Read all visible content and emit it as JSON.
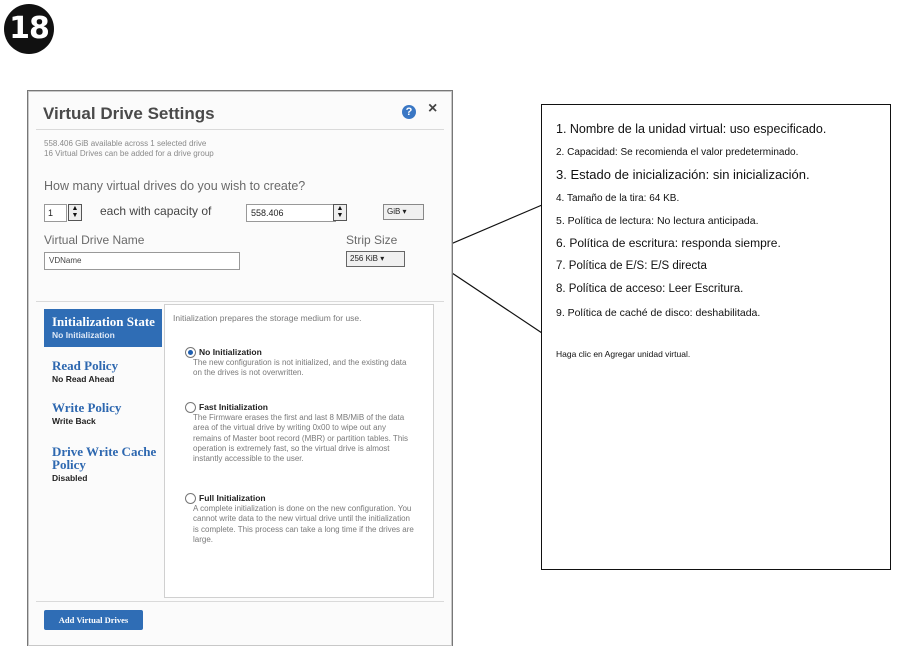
{
  "step": {
    "number": "18"
  },
  "dialog": {
    "title": "Virtual Drive Settings",
    "help_glyph": "?",
    "close_glyph": "×",
    "info_lines": [
      "558.406 GiB available across 1 selected drive",
      "16 Virtual Drives can be added for a drive group"
    ],
    "question": "How many virtual drives do you wish to create?",
    "count_value": "1",
    "capacity_label": "each with capacity of",
    "capacity_value": "558.406",
    "capacity_unit": "GiB ▾",
    "vd_name_label": "Virtual Drive Name",
    "vd_name_value": "VDName",
    "strip_size_label": "Strip Size",
    "strip_size_value": "256 KiB ▾",
    "nav": [
      {
        "title": "Initialization State",
        "value": "No Initialization",
        "active": true
      },
      {
        "title": "Read Policy",
        "value": "No Read Ahead",
        "active": false
      },
      {
        "title": "Write Policy",
        "value": "Write Back",
        "active": false
      },
      {
        "title": "Drive Write Cache Policy",
        "value": "Disabled",
        "active": false
      }
    ],
    "panel": {
      "intro": "Initialization prepares the storage medium for use.",
      "options": [
        {
          "title": "No Initialization",
          "selected": true,
          "desc": "The new configuration is not initialized, and the existing data on the drives is not overwritten."
        },
        {
          "title": "Fast Initialization",
          "selected": false,
          "desc": "The Firmware erases the first and last 8 MB/MiB of the data area of the virtual drive by writing 0x00 to wipe out any remains of Master boot record (MBR) or partition tables. This operation is extremely fast, so the virtual drive is almost instantly accessible to the user."
        },
        {
          "title": "Full Initialization",
          "selected": false,
          "desc": "A complete initialization is done on the new configuration. You cannot write data to the new virtual drive until the initialization is complete. This process can take a long time if the drives are large."
        }
      ]
    },
    "add_button_label": "Add Virtual Drives"
  },
  "callout": {
    "lines": [
      "1. Nombre de la unidad virtual: uso especificado.",
      "2. Capacidad: Se recomienda el valor predeterminado.",
      "3. Estado de inicialización: sin inicialización.",
      "4. Tamaño de la tira: 64 KB.",
      "5. Política de lectura: No lectura anticipada.",
      "6. Política de escritura: responda siempre.",
      "7. Política de E/S: E/S directa",
      "8. Política de acceso: Leer Escritura.",
      "9. Política de caché de disco: deshabilitada."
    ],
    "footer": "Haga clic en Agregar unidad virtual."
  }
}
